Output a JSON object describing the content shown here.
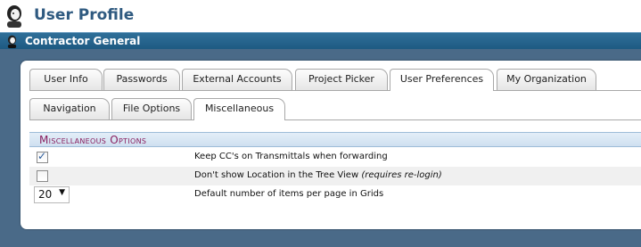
{
  "header": {
    "title": "User Profile",
    "subtitle": "Contractor General",
    "icon": "user-avatar-icon"
  },
  "tabs_primary": [
    {
      "label": "User Info",
      "active": false
    },
    {
      "label": "Passwords",
      "active": false
    },
    {
      "label": "External Accounts",
      "active": false
    },
    {
      "label": "Project Picker",
      "active": false
    },
    {
      "label": "User Preferences",
      "active": true
    },
    {
      "label": "My Organization",
      "active": false
    }
  ],
  "tabs_secondary": [
    {
      "label": "Navigation",
      "active": false
    },
    {
      "label": "File Options",
      "active": false
    },
    {
      "label": "Miscellaneous",
      "active": true
    }
  ],
  "section": {
    "title": "Miscellaneous Options"
  },
  "options": {
    "keep_cc": {
      "label": "Keep CC's on Transmittals when forwarding",
      "checked": true
    },
    "hide_location": {
      "label": "Don't show Location in the Tree View",
      "note": "(requires re-login)",
      "checked": false
    },
    "items_per_page": {
      "label": "Default number of items per page in Grids",
      "value": "20"
    }
  },
  "colors": {
    "title_text": "#2f5a80",
    "subbar": "#1e5a82",
    "background": "#4a6a88",
    "section_title": "#8a2060"
  }
}
